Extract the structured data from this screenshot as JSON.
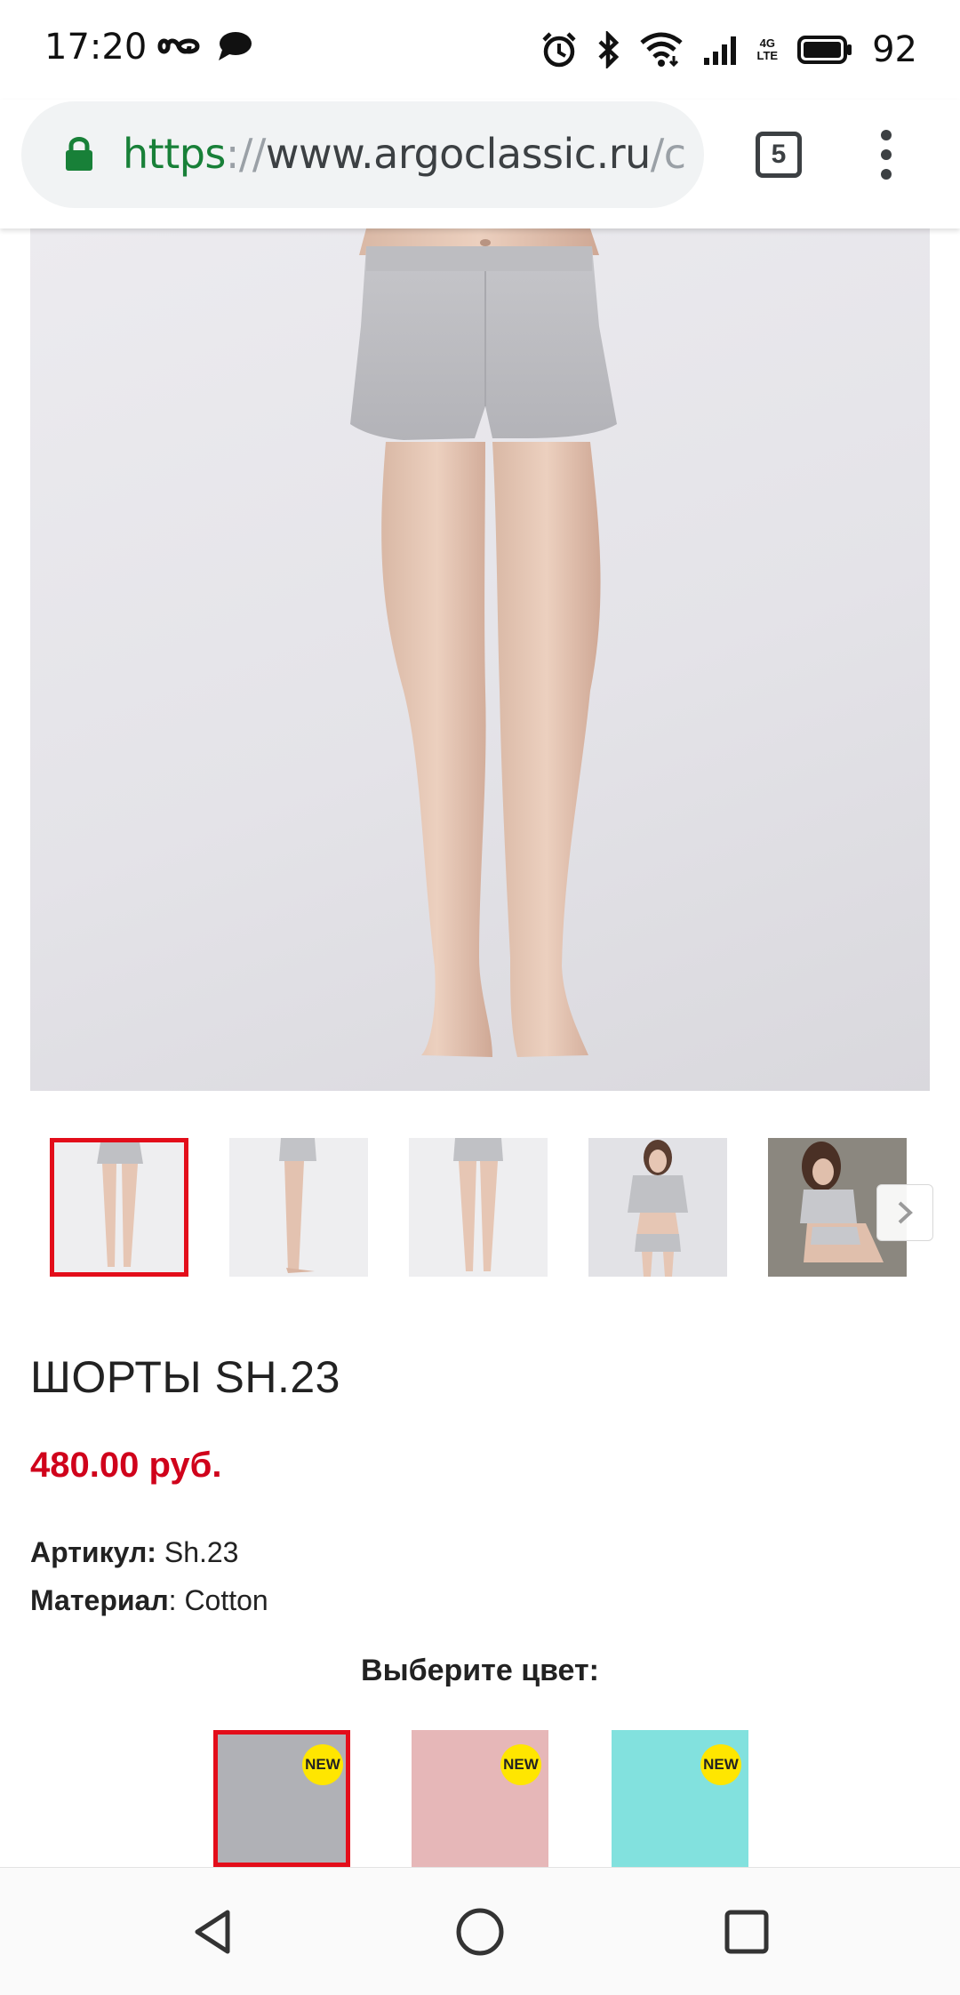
{
  "status_bar": {
    "time": "17:20",
    "battery_percent": "92",
    "network_label_top": "4G",
    "network_label_bottom": "LTE",
    "icons": [
      "infinity-icon",
      "chat-bubble-icon",
      "alarm-icon",
      "bluetooth-icon",
      "wifi-icon",
      "signal-icon",
      "battery-icon"
    ]
  },
  "browser": {
    "url_scheme": "https",
    "url_sep": "://",
    "url_host": "www.argoclassic.ru",
    "url_path": "/c",
    "tab_count": "5"
  },
  "gallery": {
    "selected_index": 0,
    "thumbnails": [
      "front-legs",
      "side-legs",
      "back-legs",
      "model-full-front",
      "model-seated"
    ]
  },
  "product": {
    "title": "ШОРТЫ SH.23",
    "price": "480.00 руб.",
    "sku_label": "Артикул:",
    "sku_value": " Sh.23",
    "material_label": "Материал",
    "material_value": ": Cotton",
    "choose_color_label": "Выберите цвет:"
  },
  "colors": [
    {
      "hex": "#b0b1b6",
      "badge": "NEW",
      "selected": true
    },
    {
      "hex": "#e6b7b8",
      "badge": "NEW",
      "selected": false
    },
    {
      "hex": "#82e1de",
      "badge": "NEW",
      "selected": false
    }
  ],
  "theme": {
    "accent_red": "#e30d1a",
    "price_red": "#d0021b",
    "badge_yellow": "#ffe600",
    "url_green": "#188038"
  }
}
